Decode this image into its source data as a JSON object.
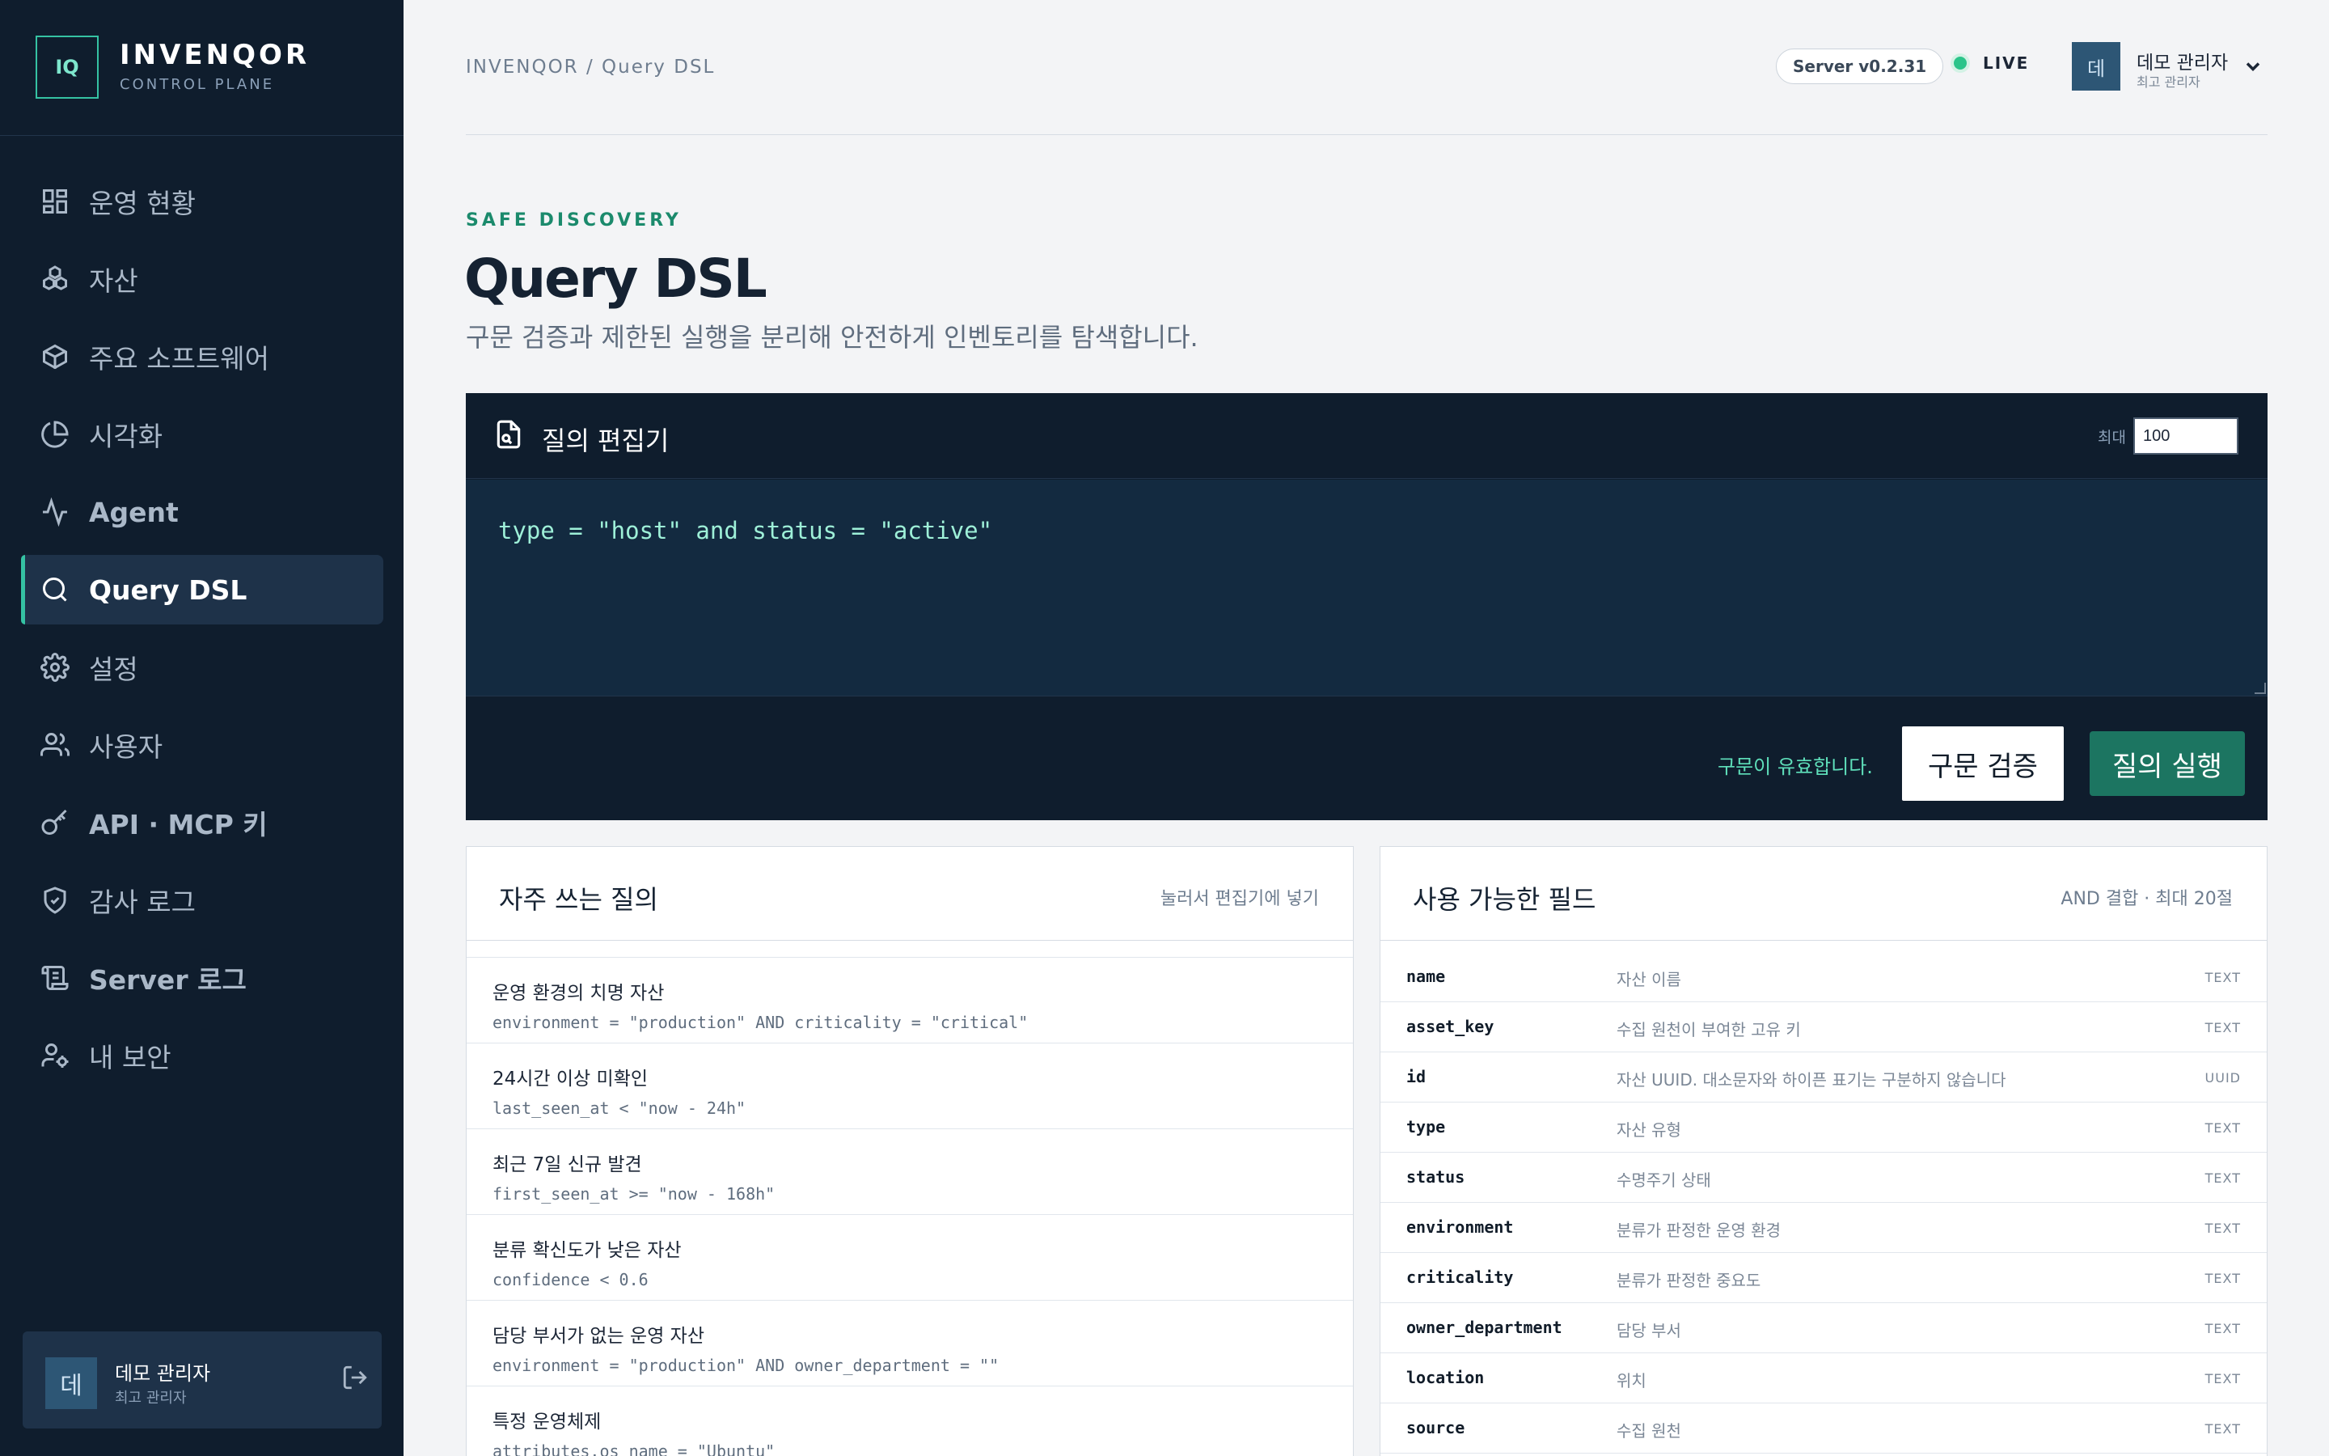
{
  "brand": {
    "logo": "IQ",
    "name": "INVENQOR",
    "sub": "CONTROL PLANE"
  },
  "nav": [
    {
      "label": "운영 현황",
      "icon": "dashboard-icon"
    },
    {
      "label": "자산",
      "icon": "assets-icon"
    },
    {
      "label": "주요 소프트웨어",
      "icon": "package-icon"
    },
    {
      "label": "시각화",
      "icon": "pie-chart-icon"
    },
    {
      "label": "Agent",
      "icon": "activity-icon"
    },
    {
      "label": "Query DSL",
      "icon": "search-icon",
      "active": true
    },
    {
      "label": "설정",
      "icon": "gear-icon"
    },
    {
      "label": "사용자",
      "icon": "users-icon"
    },
    {
      "label": "API · MCP 키",
      "icon": "key-icon"
    },
    {
      "label": "감사 로그",
      "icon": "shield-icon"
    },
    {
      "label": "Server 로그",
      "icon": "scroll-icon"
    },
    {
      "label": "내 보안",
      "icon": "user-security-icon"
    }
  ],
  "sidebar_user": {
    "avatar": "데",
    "name": "데모 관리자",
    "role": "최고 관리자"
  },
  "header": {
    "breadcrumb": "INVENQOR / Query DSL",
    "server_version": "Server v0.2.31",
    "status": "LIVE",
    "user": {
      "avatar": "데",
      "name": "데모 관리자",
      "role": "최고 관리자"
    }
  },
  "page": {
    "eyebrow": "SAFE DISCOVERY",
    "title": "Query DSL",
    "subtitle": "구문 검증과 제한된 실행을 분리해 안전하게 인벤토리를 탐색합니다."
  },
  "editor": {
    "title": "질의 편집기",
    "limit_label": "최대",
    "limit_value": "100",
    "query": "type = \"host\" and status = \"active\"",
    "valid_message": "구문이 유효합니다.",
    "validate_label": "구문 검증",
    "run_label": "질의 실행"
  },
  "frequent": {
    "title": "자주 쓰는 질의",
    "hint": "눌러서 편집기에 넣기",
    "items": [
      {
        "label": "운영 환경의 치명 자산",
        "expr": "environment = \"production\" AND criticality = \"critical\""
      },
      {
        "label": "24시간 이상 미확인",
        "expr": "last_seen_at < \"now - 24h\""
      },
      {
        "label": "최근 7일 신규 발견",
        "expr": "first_seen_at >= \"now - 168h\""
      },
      {
        "label": "분류 확신도가 낮은 자산",
        "expr": "confidence < 0.6"
      },
      {
        "label": "담당 부서가 없는 운영 자산",
        "expr": "environment = \"production\" AND owner_department = \"\""
      },
      {
        "label": "특정 운영체제",
        "expr": "attributes.os_name = \"Ubuntu\""
      }
    ]
  },
  "fields": {
    "title": "사용 가능한 필드",
    "hint": "AND 결합 · 최대 20절",
    "items": [
      {
        "name": "name",
        "desc": "자산 이름",
        "type": "TEXT"
      },
      {
        "name": "asset_key",
        "desc": "수집 원천이 부여한 고유 키",
        "type": "TEXT"
      },
      {
        "name": "id",
        "desc": "자산 UUID. 대소문자와 하이픈 표기는 구분하지 않습니다",
        "type": "UUID"
      },
      {
        "name": "type",
        "desc": "자산 유형",
        "type": "TEXT"
      },
      {
        "name": "status",
        "desc": "수명주기 상태",
        "type": "TEXT"
      },
      {
        "name": "environment",
        "desc": "분류가 판정한 운영 환경",
        "type": "TEXT"
      },
      {
        "name": "criticality",
        "desc": "분류가 판정한 중요도",
        "type": "TEXT"
      },
      {
        "name": "owner_department",
        "desc": "담당 부서",
        "type": "TEXT"
      },
      {
        "name": "location",
        "desc": "위치",
        "type": "TEXT"
      },
      {
        "name": "source",
        "desc": "수집 원천",
        "type": "TEXT"
      }
    ]
  },
  "colors": {
    "accent": "#35c2a3",
    "sidebar_bg": "#0f1d2d",
    "run_button": "#1c7561",
    "live": "#2bc48a"
  }
}
